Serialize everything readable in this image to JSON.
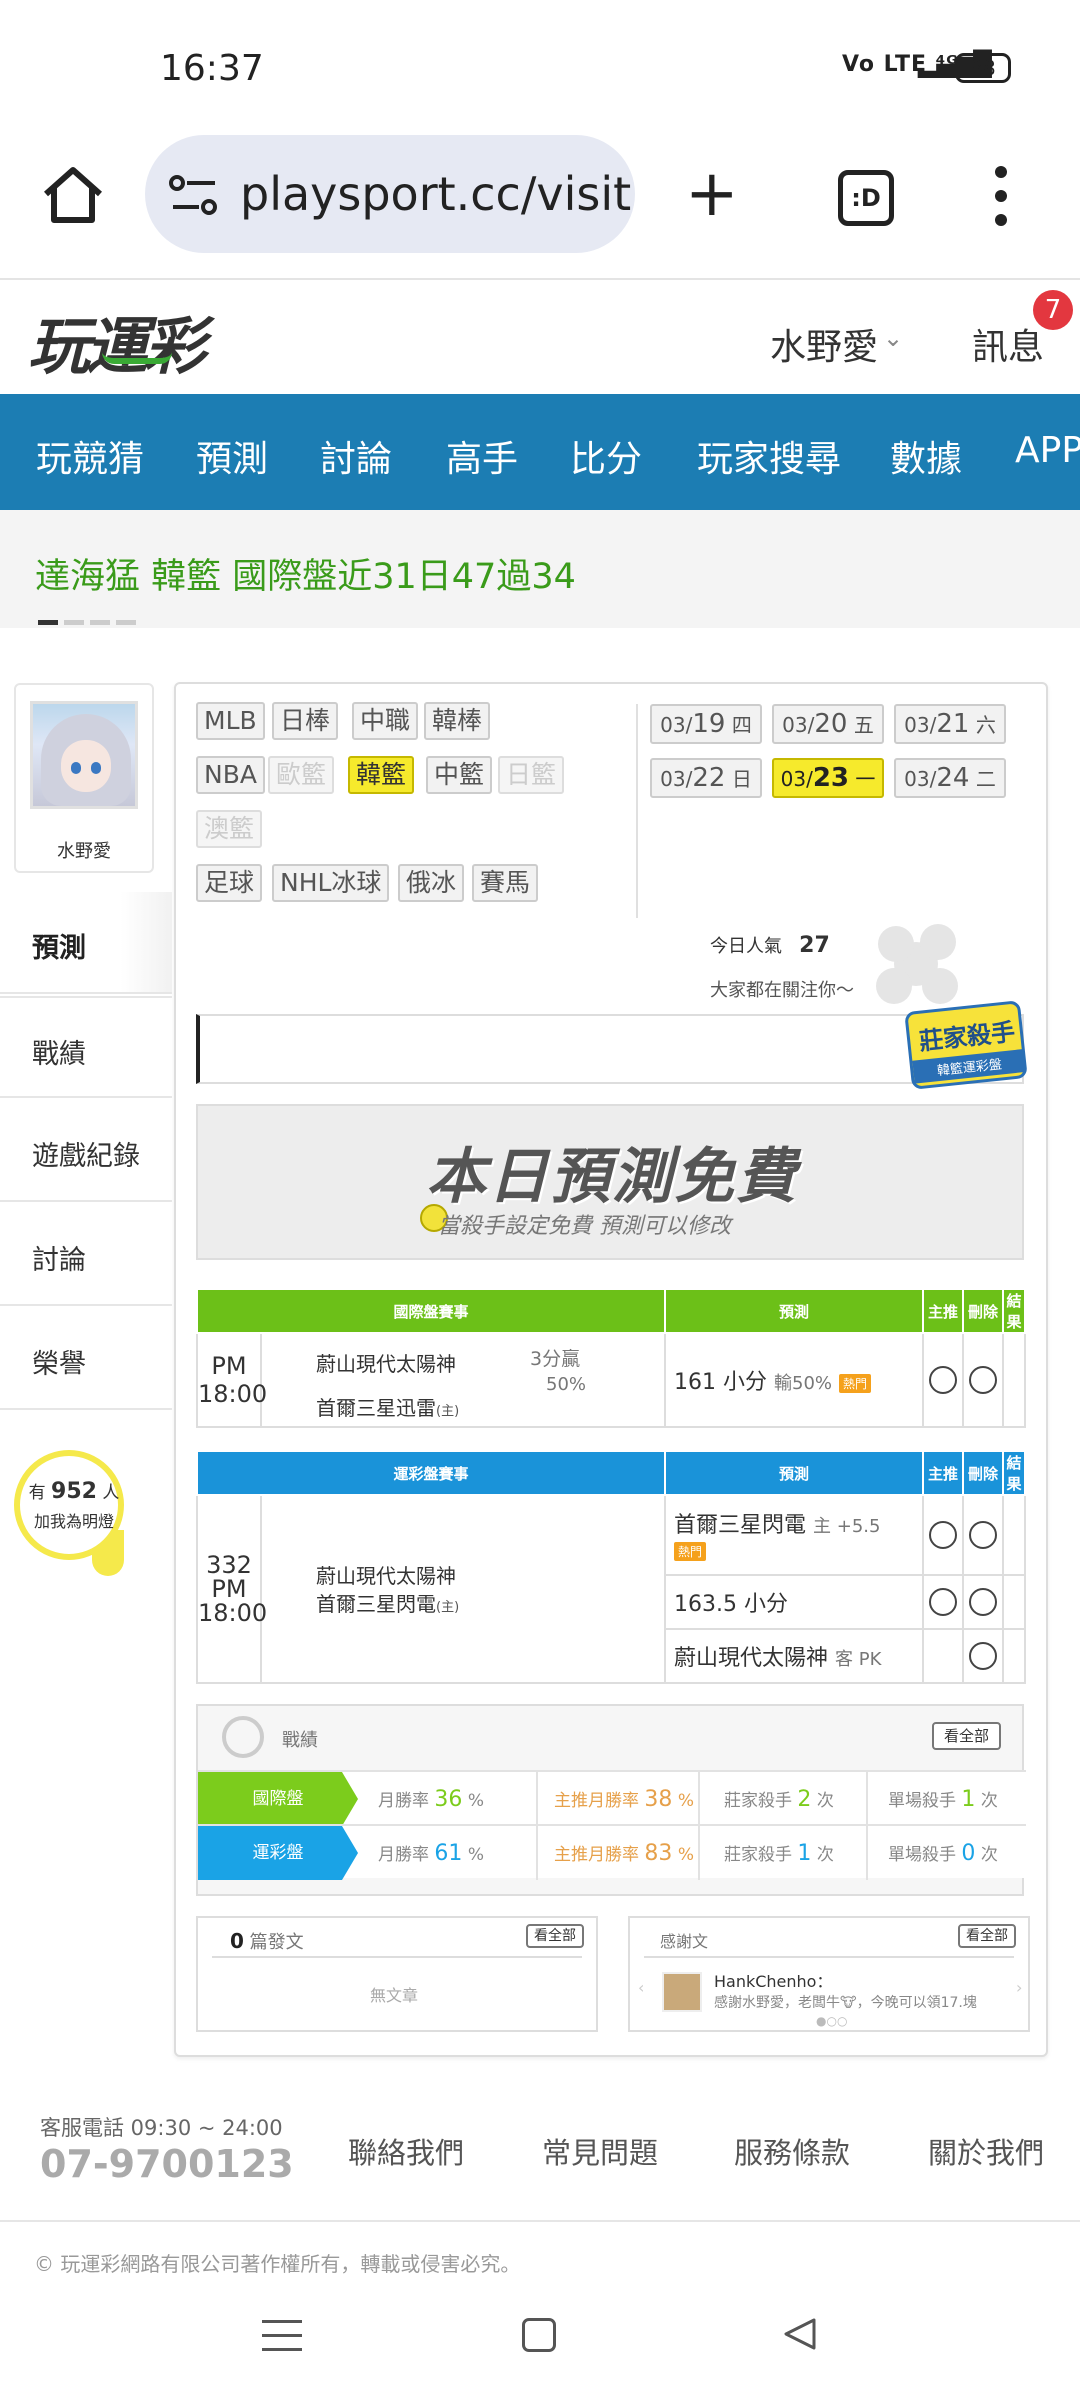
{
  "status_bar": {
    "time": "16:37",
    "network": "Vo LTE ⁴ᴳ",
    "battery": "88"
  },
  "browser": {
    "url": "playsport.cc/visit",
    "tab_label": ":D"
  },
  "site": {
    "logo": "玩運彩",
    "username": "水野愛",
    "messages_label": "訊息",
    "messages_badge": "7"
  },
  "nav": [
    "玩競猜",
    "預測",
    "討論",
    "高手",
    "比分",
    "玩家搜尋",
    "數據",
    "APP"
  ],
  "ticker": {
    "text": "達海猛 韓籃 國際盤近31日47過34"
  },
  "profile": {
    "name": "水野愛"
  },
  "sidebar": [
    "預測",
    "戰績",
    "遊戲紀錄",
    "討論",
    "榮譽"
  ],
  "bulb": {
    "prefix": "有",
    "count": "952",
    "suffix": "人",
    "line2": "加我為明燈"
  },
  "sports": {
    "row1": [
      "MLB",
      "日棒",
      "中職",
      "韓棒"
    ],
    "row2": [
      "NBA",
      "歐籃",
      "韓籃",
      "中籃",
      "日籃"
    ],
    "row3": [
      "澳籃"
    ],
    "row4": [
      "足球",
      "NHL冰球",
      "俄冰",
      "賽馬"
    ]
  },
  "dates": [
    {
      "md": "03/",
      "d": "19",
      "w": "四"
    },
    {
      "md": "03/",
      "d": "20",
      "w": "五"
    },
    {
      "md": "03/",
      "d": "21",
      "w": "六"
    },
    {
      "md": "03/",
      "d": "22",
      "w": "日"
    },
    {
      "md": "03/",
      "d": "23",
      "w": "一"
    },
    {
      "md": "03/",
      "d": "24",
      "w": "二"
    }
  ],
  "popularity": {
    "label": "今日人氣",
    "value": "27",
    "line2": "大家都在關注你～"
  },
  "badge": {
    "title": "莊家殺手",
    "subtitle": "韓籃運彩盤"
  },
  "banner": {
    "title": "本日預測免費",
    "subtitle": "當殺手設定免費  預測可以修改"
  },
  "intl_table": {
    "headers": [
      "國際盤賽事",
      "預測",
      "主推",
      "刪除",
      "結果"
    ],
    "time": "PM 18:00",
    "team_away": "蔚山現代太陽神",
    "team_home": "首爾三星迅雷",
    "home_mark": "(主)",
    "record": "3分贏",
    "record_pct": "50%",
    "pick": "161 小分",
    "pick_note": "輸50%",
    "hot": "熱門"
  },
  "lottery_table": {
    "headers": [
      "運彩盤賽事",
      "預測",
      "主推",
      "刪除",
      "結果"
    ],
    "game_no": "332",
    "time": "PM 18:00",
    "team_away": "蔚山現代太陽神",
    "team_home": "首爾三星閃電",
    "home_mark": "(主)",
    "pick1": "首爾三星閃電",
    "pick1_note": "主 +5.5",
    "hot": "熱門",
    "pick2": "163.5 小分",
    "pick3": "蔚山現代太陽神",
    "pick3_note": "客 PK"
  },
  "stats": {
    "title": "戰績",
    "see_all": "看全部",
    "rows": [
      {
        "label": "國際盤",
        "win_label": "月勝率",
        "win": "36",
        "main_label": "主推月勝率",
        "main": "38",
        "pct": "%",
        "killer_label": "莊家殺手",
        "killer": "2",
        "single_label": "單場殺手",
        "single": "1",
        "unit": "次",
        "color": "#7ccc1c"
      },
      {
        "label": "運彩盤",
        "win_label": "月勝率",
        "win": "61",
        "main_label": "主推月勝率",
        "main": "83",
        "pct": "%",
        "killer_label": "莊家殺手",
        "killer": "1",
        "single_label": "單場殺手",
        "single": "0",
        "unit": "次",
        "color": "#1aa3e6"
      }
    ]
  },
  "posts": {
    "count": "0",
    "label": "篇發文",
    "see_all": "看全部",
    "empty": "無文章"
  },
  "thanks": {
    "label": "感謝文",
    "see_all": "看全部",
    "user": "HankChenho：",
    "text": "感謝水野愛，老闆牛🐮，今晚可以領17.塊"
  },
  "footer": {
    "phone_label": "客服電話 09:30 ~ 24:00",
    "phone": "07-9700123",
    "links": [
      "聯絡我們",
      "常見問題",
      "服務條款",
      "關於我們"
    ],
    "copyright": "© 玩運彩網路有限公司著作權所有，轉載或侵害必究。"
  },
  "colors": {
    "nav": "#1c7db3",
    "ticker_text": "#3a9b1a",
    "green_header": "#6cc018",
    "blue_header": "#1a93d9",
    "selected": "#f6ea2c",
    "badge": "#e3373f"
  }
}
